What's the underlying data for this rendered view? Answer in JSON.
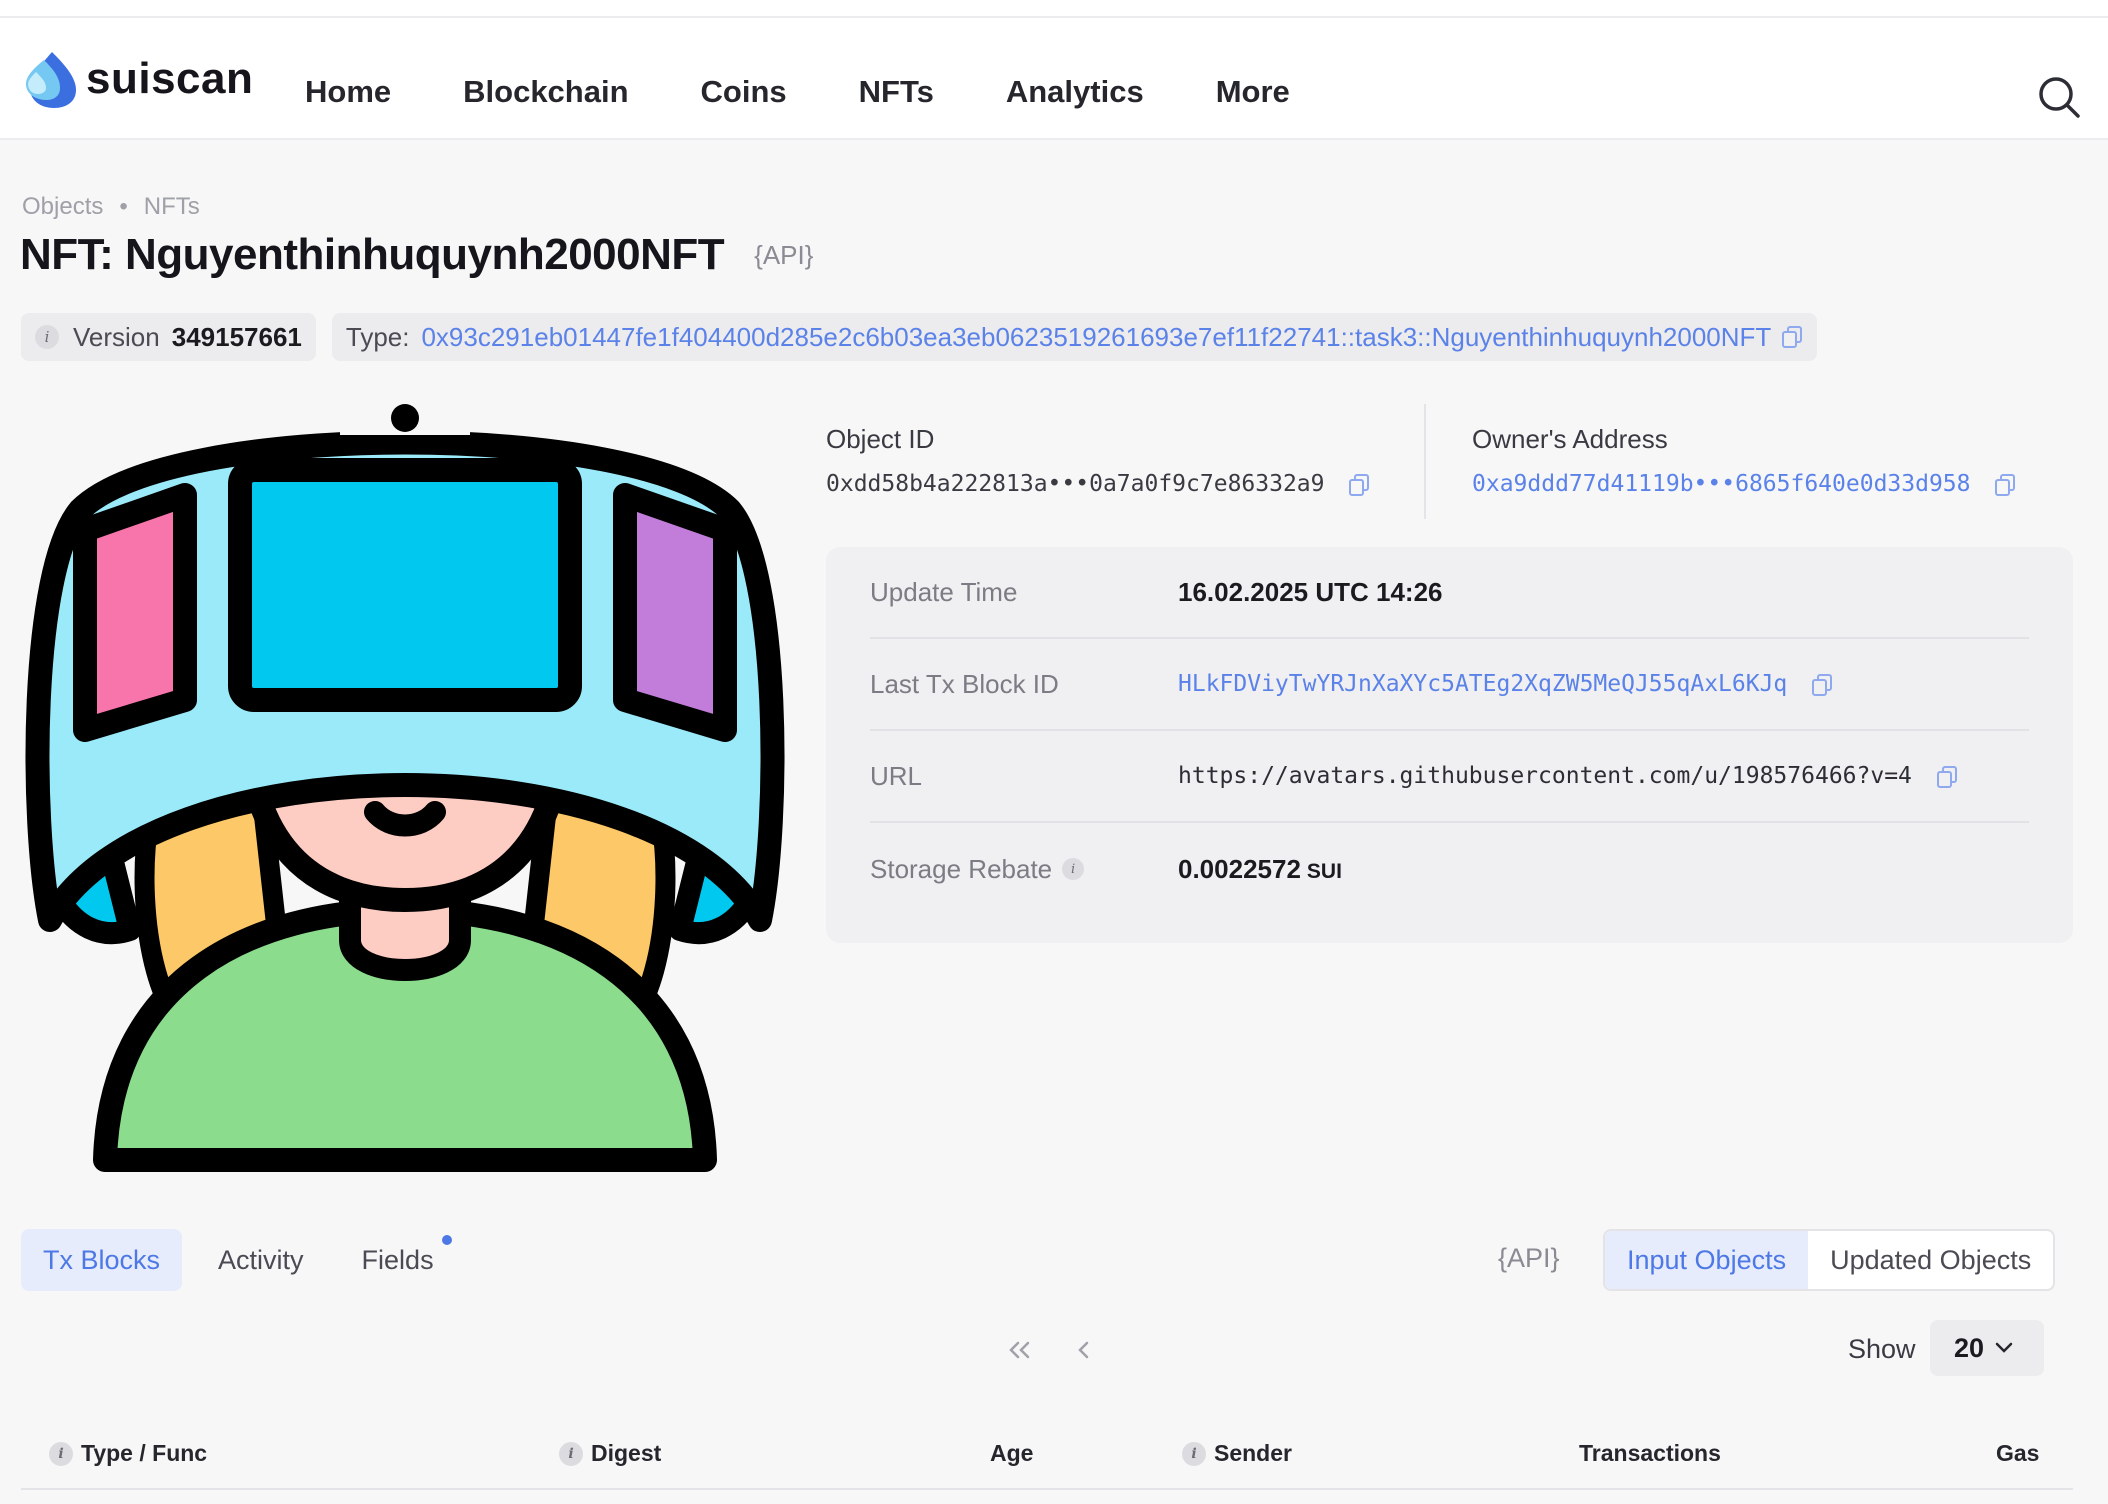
{
  "app": {
    "name": "suiscan"
  },
  "nav": [
    "Home",
    "Blockchain",
    "Coins",
    "NFTs",
    "Analytics",
    "More"
  ],
  "breadcrumb": [
    "Objects",
    "NFTs"
  ],
  "title": "NFT: Nguyenthinhuquynh2000NFT",
  "api_label": "{API}",
  "version": {
    "label": "Version",
    "value": "349157661"
  },
  "type": {
    "label": "Type:",
    "value": "0x93c291eb01447fe1f404400d285e2c6b03ea3eb0623519261693e7ef11f22741::task3::Nguyenthinhuquynh2000NFT"
  },
  "object_id": {
    "label": "Object ID",
    "value": "0xdd58b4a222813a•••0a7a0f9c7e86332a9"
  },
  "owner": {
    "label": "Owner's Address",
    "value": "0xa9ddd77d41119b•••6865f640e0d33d958"
  },
  "details": [
    {
      "label": "Update Time",
      "value": "16.02.2025 UTC 14:26"
    },
    {
      "label": "Last Tx Block ID",
      "value": "HLkFDViyTwYRJnXaXYc5ATEg2XqZW5MeQJ55qAxL6KJq"
    },
    {
      "label": "URL",
      "value": "https://avatars.githubusercontent.com/u/198576466?v=4"
    },
    {
      "label": "Storage Rebate",
      "value": "0.0022572",
      "unit": "SUI"
    }
  ],
  "tabs": [
    "Tx Blocks",
    "Activity",
    "Fields"
  ],
  "segments": [
    "Input Objects",
    "Updated Objects"
  ],
  "show": {
    "label": "Show",
    "value": "20"
  },
  "table_headers": [
    "Type / Func",
    "Digest",
    "Age",
    "Sender",
    "Transactions",
    "Gas"
  ],
  "colors": {
    "link": "#5a82e8",
    "accent": "#4d78e6",
    "active_bg": "#e6ecfb"
  }
}
